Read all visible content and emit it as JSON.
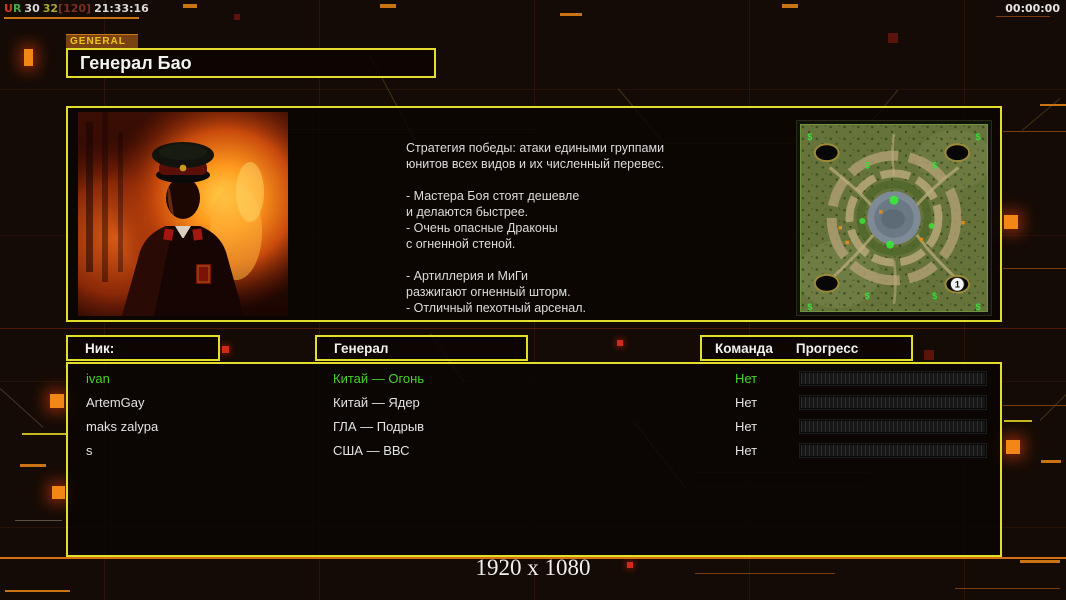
{
  "status_bar": {
    "u": "U",
    "r": "R",
    "n1": "30",
    "n2": "32",
    "n3": "[120]",
    "clock": "21:33:16",
    "timer": "00:00:00"
  },
  "header": {
    "tab": "GENERAL",
    "title": "Генерал Бао"
  },
  "general_info": {
    "portrait_name": "general-bao-portrait",
    "strategy": "Стратегия победы: атаки едиными группами\nюнитов всех видов и их численный перевес.\n\n- Мастера Боя стоят дешевле\nи делаются быстрее.\n- Очень опасные Драконы\nс огненной стеной.\n\n- Артиллерия и МиГи\nразжигают огненный шторм.\n- Отличный пехотный арсенал.",
    "minimap": {
      "start_marker": "1",
      "supply_symbol": "$"
    }
  },
  "table": {
    "headers": {
      "nick": "Ник:",
      "general": "Генерал",
      "team": "Команда",
      "progress": "Прогресс"
    },
    "rows": [
      {
        "nick": "ivan",
        "general": "Китай — Огонь",
        "team": "Нет"
      },
      {
        "nick": "ArtemGay",
        "general": "Китай — Ядер",
        "team": "Нет"
      },
      {
        "nick": "maks zalypa",
        "general": "ГЛА — Подрыв",
        "team": "Нет"
      },
      {
        "nick": "s",
        "general": "США — ВВС",
        "team": "Нет"
      }
    ]
  },
  "footer": {
    "resolution": "1920 x 1080"
  },
  "colors": {
    "accent_yellow": "#e3de2a",
    "accent_orange": "#f28718",
    "highlight_green": "#44d226",
    "text_white": "#e6e6e6"
  }
}
